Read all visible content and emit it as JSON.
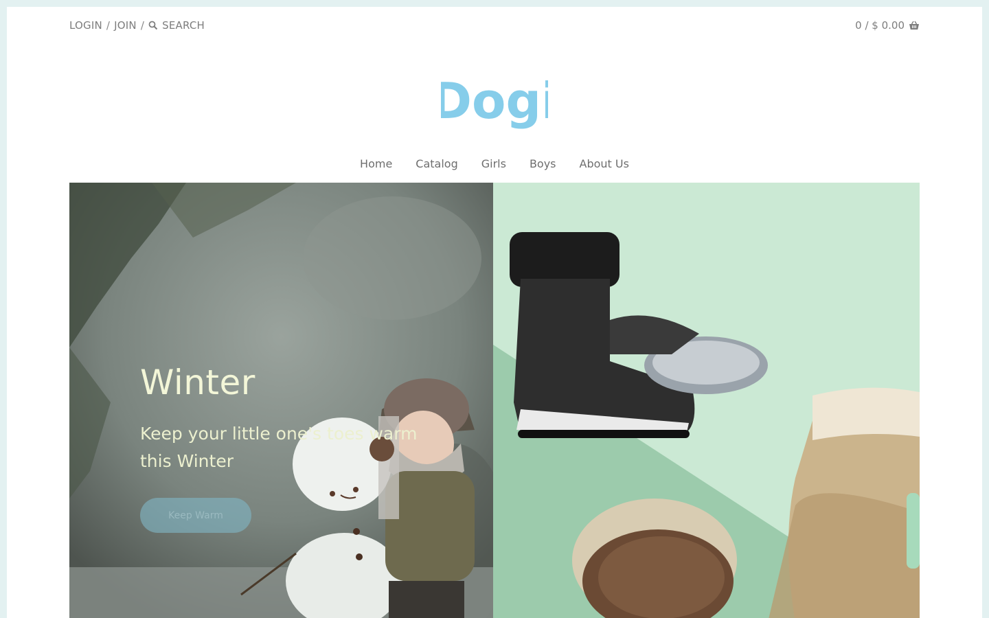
{
  "header": {
    "login": "LOGIN",
    "join": "JOIN",
    "separator": "/",
    "search_placeholder": "SEARCH",
    "cart_text": "0 / $ 0.00"
  },
  "logo": {
    "text": "Dogi",
    "color": "#86cdea"
  },
  "nav": {
    "items": [
      {
        "label": "Home"
      },
      {
        "label": "Catalog"
      },
      {
        "label": "Girls"
      },
      {
        "label": "Boys"
      },
      {
        "label": "About Us"
      }
    ]
  },
  "hero": {
    "title": "Winter",
    "subtitle": "Keep your little one's toes warm this Winter",
    "button_label": "Keep Warm"
  },
  "colors": {
    "page_background": "#e3f1f1",
    "accent_green": "#cbe9d4",
    "logo_blue": "#86cdea"
  }
}
